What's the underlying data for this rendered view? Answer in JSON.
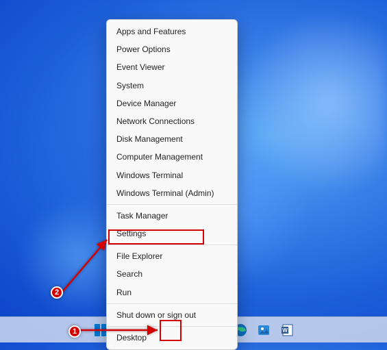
{
  "menu": {
    "items": [
      "Apps and Features",
      "Power Options",
      "Event Viewer",
      "System",
      "Device Manager",
      "Network Connections",
      "Disk Management",
      "Computer Management",
      "Windows Terminal",
      "Windows Terminal (Admin)",
      "Task Manager",
      "Settings",
      "File Explorer",
      "Search",
      "Run",
      "Shut down or sign out",
      "Desktop"
    ],
    "separatorsAfterIndex": [
      9,
      11,
      14,
      15
    ],
    "highlightedIndex": 11
  },
  "taskbar": {
    "icons": [
      {
        "name": "start-icon"
      },
      {
        "name": "search-icon"
      },
      {
        "name": "task-view-icon"
      },
      {
        "name": "widgets-icon"
      },
      {
        "name": "file-explorer-icon"
      },
      {
        "name": "chat-icon"
      },
      {
        "name": "edge-icon"
      },
      {
        "name": "photos-icon"
      },
      {
        "name": "word-icon"
      }
    ]
  },
  "annotations": {
    "badge1": "1",
    "badge2": "2"
  },
  "colors": {
    "highlight": "#d40000"
  }
}
